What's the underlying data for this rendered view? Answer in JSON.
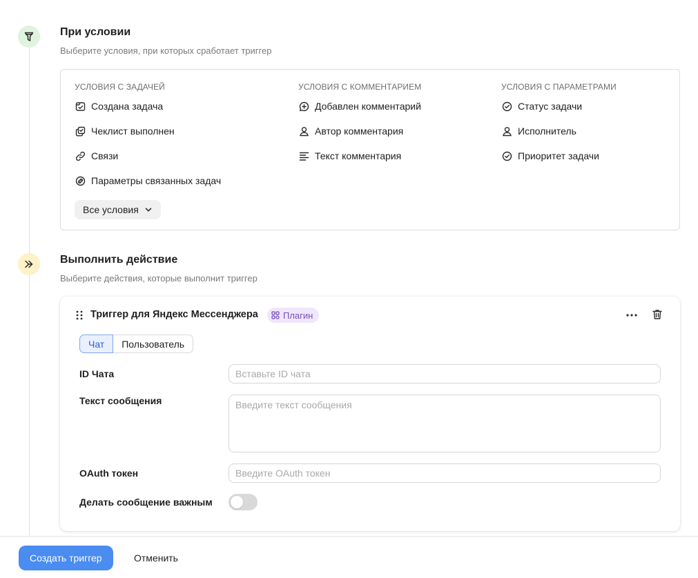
{
  "condition_step": {
    "title": "При условии",
    "subtitle": "Выберите условия, при которых сработает триггер",
    "icon": "filter-icon",
    "columns": [
      {
        "title": "УСЛОВИЯ С ЗАДАЧЕЙ",
        "items": [
          {
            "label": "Создана задача",
            "icon": "task-created-icon"
          },
          {
            "label": "Чеклист выполнен",
            "icon": "checklist-icon"
          },
          {
            "label": "Связи",
            "icon": "link-icon"
          },
          {
            "label": "Параметры связанных задач",
            "icon": "linked-params-icon"
          }
        ]
      },
      {
        "title": "УСЛОВИЯ С КОММЕНТАРИЕМ",
        "items": [
          {
            "label": "Добавлен комментарий",
            "icon": "comment-add-icon"
          },
          {
            "label": "Автор комментария",
            "icon": "person-icon"
          },
          {
            "label": "Текст комментария",
            "icon": "text-lines-icon"
          }
        ]
      },
      {
        "title": "УСЛОВИЯ С ПАРАМЕТРАМИ",
        "items": [
          {
            "label": "Статус задачи",
            "icon": "check-circle-icon"
          },
          {
            "label": "Исполнитель",
            "icon": "person-icon"
          },
          {
            "label": "Приоритет задачи",
            "icon": "check-circle-icon"
          }
        ]
      }
    ],
    "all_conditions_label": "Все условия"
  },
  "action_step": {
    "title": "Выполнить действие",
    "subtitle": "Выберите действия, которые выполнит триггер",
    "icon": "double-arrow-icon",
    "card": {
      "title": "Триггер для Яндекс Мессенджера",
      "badge": "Плагин",
      "tabs": [
        {
          "label": "Чат",
          "active": true
        },
        {
          "label": "Пользователь",
          "active": false
        }
      ],
      "fields": {
        "chat_id": {
          "label": "ID Чата",
          "value": "",
          "placeholder": "Вставьте ID чата"
        },
        "message": {
          "label": "Текст сообщения",
          "value": "",
          "placeholder": "Введите текст сообщения"
        },
        "oauth": {
          "label": "OAuth токен",
          "value": "",
          "placeholder": "Введите OAuth токен"
        },
        "important": {
          "label": "Делать сообщение важным",
          "enabled": false
        }
      }
    }
  },
  "footer": {
    "create_label": "Создать триггер",
    "cancel_label": "Отменить"
  },
  "colors": {
    "primary": "#4a8cf0",
    "badge_bg": "#efe6fb",
    "badge_text": "#7a4fb8",
    "condition_icon_bg": "#dff3df",
    "action_icon_bg": "#fdf1c8"
  }
}
